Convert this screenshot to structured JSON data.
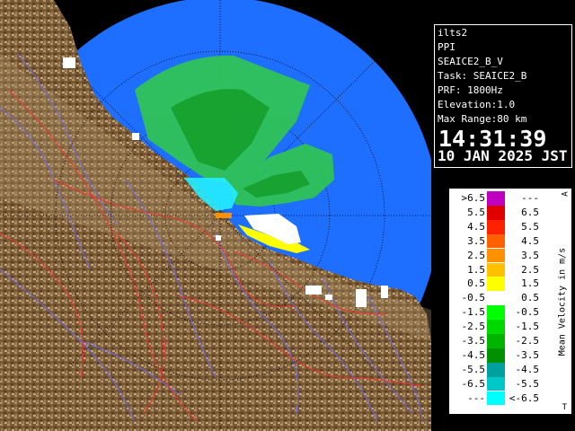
{
  "info": {
    "station": "ilts2",
    "scan_type": "PPI",
    "product": "SEAICE2_B_V",
    "task": "Task: SEAICE2_B",
    "prf": "PRF: 1800Hz",
    "elevation": "Elevation:1.0",
    "max_range": "Max Range:80 km",
    "time": "14:31:39",
    "date": "10 JAN 2025 JST"
  },
  "legend": {
    "title": "Mean Velocity in m/s",
    "top_mark": "A",
    "bottom_mark": "T",
    "rows": [
      {
        "lo": ">6.5",
        "hi": "---",
        "color": "#c000c0"
      },
      {
        "lo": "5.5",
        "hi": "6.5",
        "color": "#e00000"
      },
      {
        "lo": "4.5",
        "hi": "5.5",
        "color": "#ff2000"
      },
      {
        "lo": "3.5",
        "hi": "4.5",
        "color": "#ff6000"
      },
      {
        "lo": "2.5",
        "hi": "3.5",
        "color": "#ff9000"
      },
      {
        "lo": "1.5",
        "hi": "2.5",
        "color": "#ffc000"
      },
      {
        "lo": "0.5",
        "hi": "1.5",
        "color": "#ffff00"
      },
      {
        "lo": "-0.5",
        "hi": "0.5",
        "color": "#ffffff"
      },
      {
        "lo": "-1.5",
        "hi": "-0.5",
        "color": "#00ff00"
      },
      {
        "lo": "-2.5",
        "hi": "-1.5",
        "color": "#00d800"
      },
      {
        "lo": "-3.5",
        "hi": "-2.5",
        "color": "#00b400"
      },
      {
        "lo": "-4.5",
        "hi": "-3.5",
        "color": "#009000"
      },
      {
        "lo": "-5.5",
        "hi": "-4.5",
        "color": "#00a0a0"
      },
      {
        "lo": "-6.5",
        "hi": "-5.5",
        "color": "#00c8c8"
      },
      {
        "lo": "---",
        "hi": "<-6.5",
        "color": "#00ffff"
      }
    ]
  },
  "colors": {
    "sea": "#1e6eff",
    "outside_range": "#5ea0ff",
    "land": "#7a5a36",
    "land_light": "#b09468",
    "echo_green": "#33cc44",
    "echo_cyan": "#22eeff",
    "echo_yellow": "#ffff00",
    "river": "#6a6aff",
    "boundary": "#ff3030"
  }
}
